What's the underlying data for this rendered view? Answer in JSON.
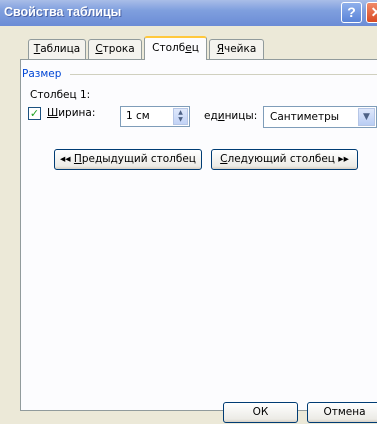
{
  "window": {
    "title": "Свойства таблицы",
    "help_glyph": "?",
    "close_glyph": "✕"
  },
  "tabs": [
    {
      "label_pre": "",
      "label_acc": "Т",
      "label_post": "аблица"
    },
    {
      "label_pre": "",
      "label_acc": "С",
      "label_post": "трока"
    },
    {
      "label_pre": "Столб",
      "label_acc": "е",
      "label_post": "ц"
    },
    {
      "label_pre": "",
      "label_acc": "Я",
      "label_post": "чейка"
    }
  ],
  "size_group": {
    "label": "Размер",
    "column_label": "Столбец 1:",
    "width_checked_glyph": "✓",
    "width_label_acc": "Ш",
    "width_label_post": "ирина:",
    "width_value": "1 см",
    "spinner_up": "▲",
    "spinner_down": "▼",
    "units_label_pre": "ед",
    "units_label_acc": "и",
    "units_label_post": "ницы:",
    "units_value": "Сантиметры",
    "dropdown_glyph": "▼"
  },
  "nav": {
    "prev_arrows": "◂◂",
    "prev_acc": "П",
    "prev_post": "редыдущий столбец",
    "next_acc": "С",
    "next_post": "ледующий столбец",
    "next_arrows": "▸▸"
  },
  "footer": {
    "ok_label": "ОК",
    "cancel_label": "Отмена"
  }
}
